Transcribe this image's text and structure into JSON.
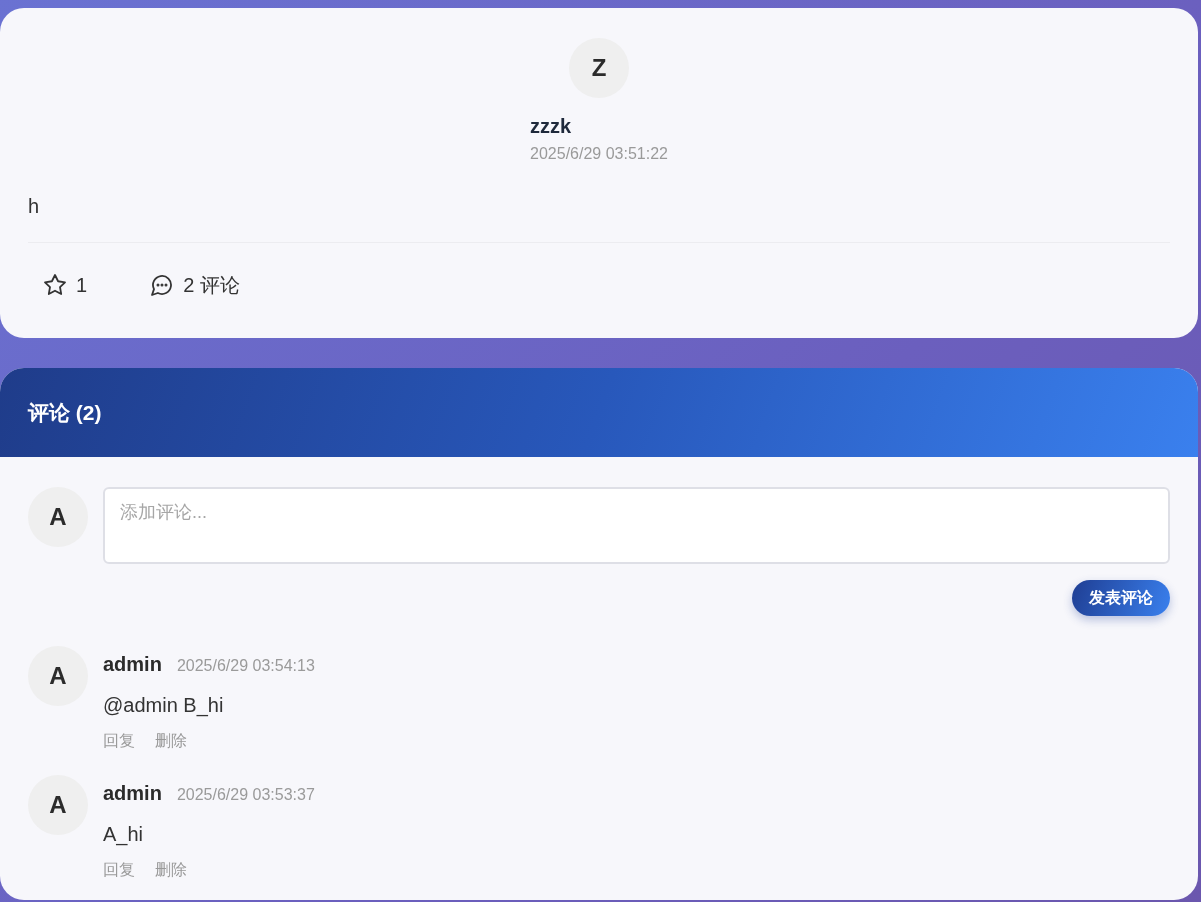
{
  "post": {
    "avatar": "Z",
    "author": "zzzk",
    "time": "2025/6/29 03:51:22",
    "content": "h",
    "likes": "1",
    "comments_label": "2 评论"
  },
  "comments_panel": {
    "title": "评论 (2)",
    "composer": {
      "avatar": "A",
      "placeholder": "添加评论...",
      "submit": "发表评论"
    },
    "comments": [
      {
        "avatar": "A",
        "author": "admin",
        "time": "2025/6/29 03:54:13",
        "text": "@admin B_hi",
        "actions": [
          "回复",
          "删除"
        ]
      },
      {
        "avatar": "A",
        "author": "admin",
        "time": "2025/6/29 03:53:37",
        "text": "A_hi",
        "actions": [
          "回复",
          "删除"
        ]
      }
    ]
  }
}
